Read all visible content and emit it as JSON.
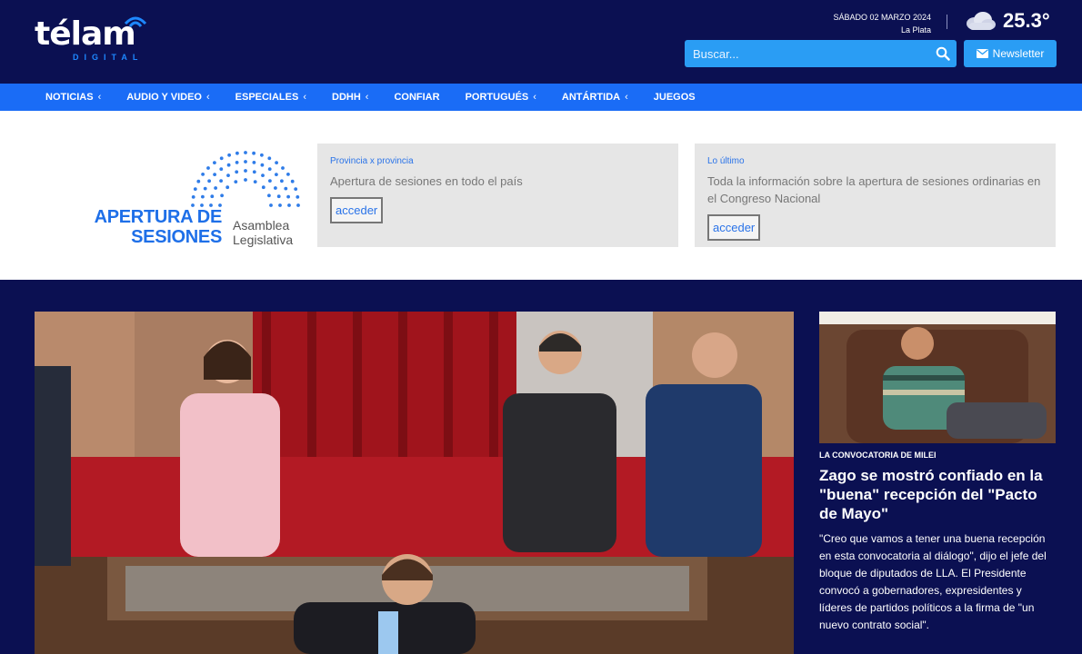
{
  "header": {
    "logo_text": "télam",
    "logo_sub": "DIGITAL",
    "date": "SÁBADO 02 MARZO 2024",
    "city": "La Plata",
    "temperature": "25.3°",
    "search_placeholder": "Buscar...",
    "newsletter_label": "Newsletter",
    "weather_icon": "cloud-icon"
  },
  "nav": {
    "items": [
      {
        "label": "NOTICIAS",
        "has_chevron": true
      },
      {
        "label": "AUDIO Y VIDEO",
        "has_chevron": true
      },
      {
        "label": "ESPECIALES",
        "has_chevron": true
      },
      {
        "label": "DDHH",
        "has_chevron": true
      },
      {
        "label": "CONFIAR",
        "has_chevron": false
      },
      {
        "label": "PORTUGUÉS",
        "has_chevron": true
      },
      {
        "label": "ANTÁRTIDA",
        "has_chevron": true
      },
      {
        "label": "JUEGOS",
        "has_chevron": false
      }
    ],
    "chevron": "‹"
  },
  "banner": {
    "title_line1": "APERTURA DE",
    "title_line2": "SESIONES",
    "sub_line1": "Asamblea",
    "sub_line2": "Legislativa",
    "cards": [
      {
        "kicker": "Provincia x provincia",
        "text": "Apertura de sesiones en todo el país",
        "button": "acceder"
      },
      {
        "kicker": "Lo último",
        "text": "Toda la información sobre la apertura de sesiones ordinarias en el Congreso Nacional",
        "button": "acceder"
      }
    ]
  },
  "side_story": {
    "kicker": "LA CONVOCATORIA DE MILEI",
    "title": "Zago se mostró confiado en la \"buena\" recepción del \"Pacto de Mayo\"",
    "body": "\"Creo que vamos a tener una buena recepción en esta convocatoria al diálogo\", dijo el jefe del bloque de diputados de LLA. El Presidente convocó a gobernadores, expresidentes y líderes de partidos políticos a la firma de \"un nuevo contrato social\"."
  },
  "colors": {
    "navy": "#0b1052",
    "nav_blue": "#1a6cf6",
    "accent_blue": "#2a9df4"
  }
}
